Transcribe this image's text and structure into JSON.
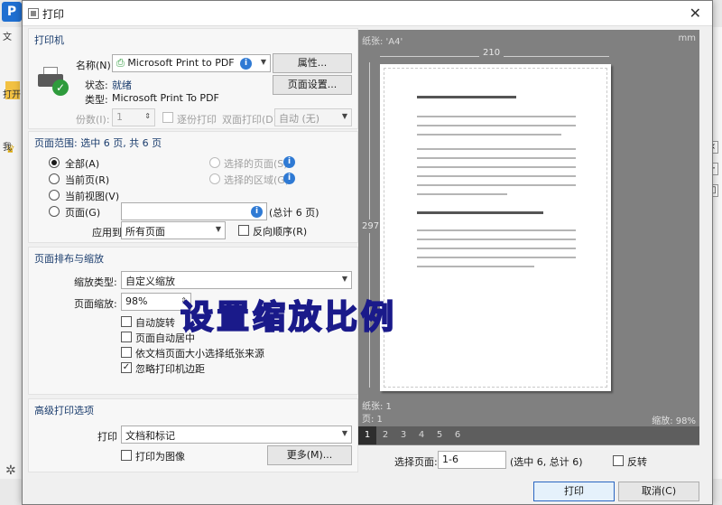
{
  "background_app": {
    "logo_text": "P",
    "menu_item": "文",
    "toolbar_label_open": "打开",
    "tab_label": "我"
  },
  "dialog": {
    "title": "打印",
    "close_glyph": "✕"
  },
  "printer": {
    "section_title": "打印机",
    "name_label": "名称(N):",
    "name_value": "Microsoft Print to PDF",
    "properties_button": "属性...",
    "status_label": "状态:",
    "status_value": "就绪",
    "type_label": "类型:",
    "type_value": "Microsoft Print To PDF",
    "page_setup_button": "页面设置...",
    "copies_label": "份数(I):",
    "copies_value": "1",
    "collate_label": "逐份打印",
    "duplex_label": "双面打印(D)",
    "duplex_value": "自动 (无)"
  },
  "page_range": {
    "section_title": "页面范围: 选中 6 页, 共 6 页",
    "all_label": "全部(A)",
    "current_label": "当前页(R)",
    "current_view_label": "当前视图(V)",
    "pages_label": "页面(G)",
    "selected_pages_label": "选择的页面(S)",
    "selected_area_label": "选择的区域(G)",
    "total_label": "(总计 6 页)",
    "apply_label": "应用到:",
    "apply_value": "所有页面",
    "reverse_label": "反向顺序(R)"
  },
  "layout": {
    "section_title": "页面排布与缩放",
    "scale_type_label": "缩放类型:",
    "scale_type_value": "自定义缩放",
    "page_scale_label": "页面缩放:",
    "page_scale_value": "98%",
    "auto_rotate_label": "自动旋转",
    "auto_center_label": "页面自动居中",
    "paper_source_label": "依文档页面大小选择纸张来源",
    "ignore_margins_label": "忽略打印机边距",
    "ignore_margins_checked": true
  },
  "advanced": {
    "section_title": "高级打印选项",
    "print_label": "打印",
    "print_value": "文档和标记",
    "print_as_image_label": "打印为图像",
    "more_button": "更多(M)..."
  },
  "preview": {
    "paper_label": "纸张: 'A4'",
    "unit": "mm",
    "width_mm": "210",
    "height_mm": "297",
    "sheets_label": "纸张: 1",
    "page_label": "页: 1",
    "zoom_label": "缩放: 98%",
    "page_numbers": [
      "1",
      "2",
      "3",
      "4",
      "5",
      "6"
    ],
    "active_page": "1"
  },
  "footer": {
    "select_pages_label": "选择页面:",
    "select_pages_value": "1-6",
    "select_pages_info": "(选中 6, 总计 6)",
    "reverse_label": "反转",
    "print_button": "打印",
    "cancel_button": "取消(C)"
  },
  "overlay_caption": "设置缩放比例"
}
